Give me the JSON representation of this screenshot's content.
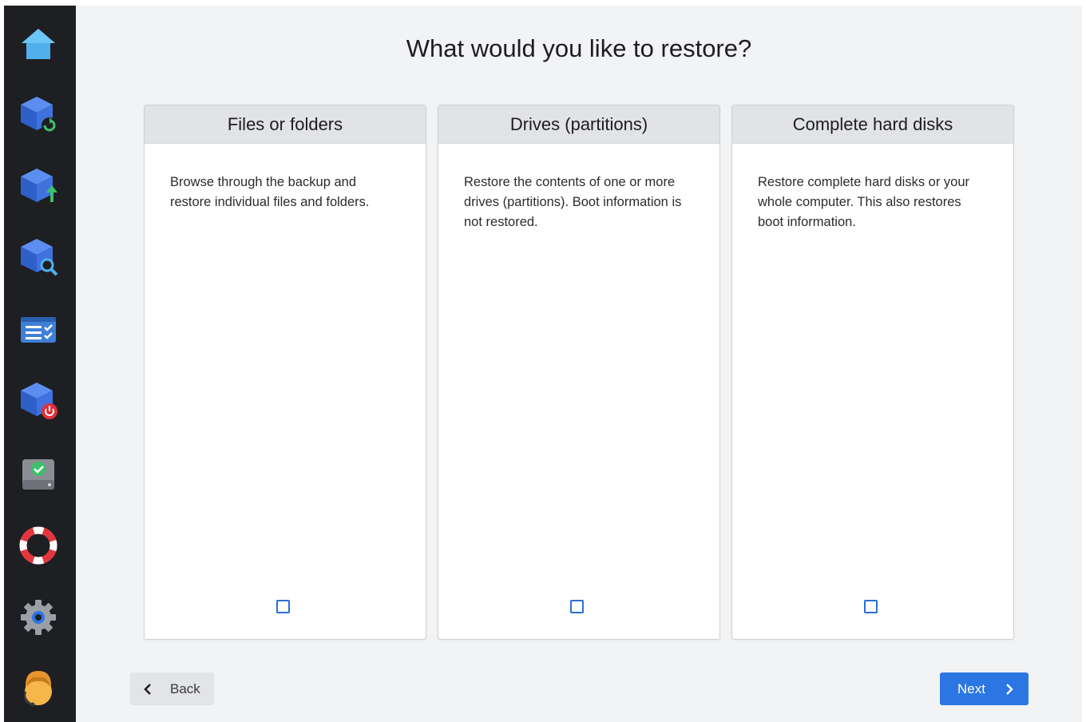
{
  "page": {
    "title": "What would you like to restore?"
  },
  "sidebar": {
    "items": [
      {
        "name": "home-icon"
      },
      {
        "name": "backup-sync-icon"
      },
      {
        "name": "backup-upload-icon"
      },
      {
        "name": "backup-search-icon"
      },
      {
        "name": "task-list-icon"
      },
      {
        "name": "backup-power-icon"
      },
      {
        "name": "drive-check-icon"
      },
      {
        "name": "lifebuoy-icon"
      },
      {
        "name": "gear-icon"
      },
      {
        "name": "user-avatar-icon"
      }
    ]
  },
  "options": [
    {
      "header": "Files or folders",
      "description": "Browse through the backup and restore individual files and folders.",
      "checked": false
    },
    {
      "header": "Drives (partitions)",
      "description": "Restore the contents of one or more drives (partitions). Boot information is not restored.",
      "checked": false
    },
    {
      "header": "Complete hard disks",
      "description": "Restore complete hard disks or your whole computer. This also restores boot information.",
      "checked": false
    }
  ],
  "footer": {
    "back_label": "Back",
    "next_label": "Next"
  },
  "colors": {
    "sidebar_bg": "#1e1f22",
    "accent": "#2c76e4",
    "checkbox": "#2a6fd6"
  }
}
